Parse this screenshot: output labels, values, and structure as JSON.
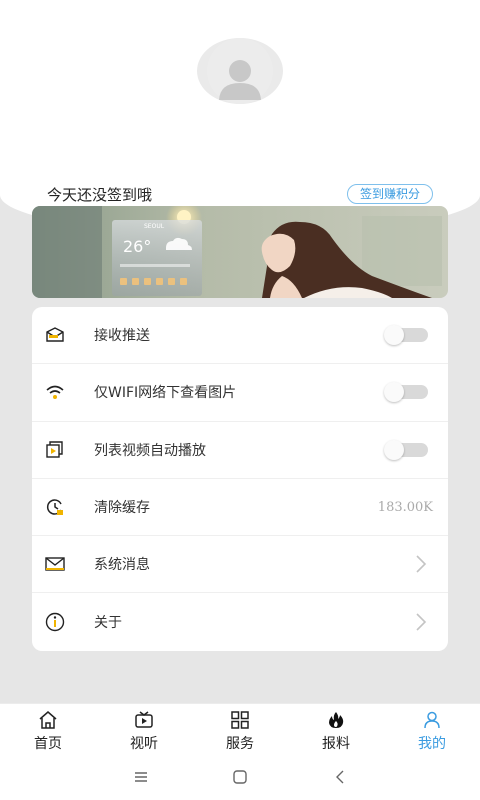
{
  "profile": {
    "signin_prompt": "今天还没签到哦",
    "signin_button": "签到赚积分"
  },
  "banner": {
    "city": "SEOUL",
    "temperature": "26°"
  },
  "settings": [
    {
      "icon": "envelope-open-icon",
      "label": "接收推送",
      "control": "toggle",
      "on": false
    },
    {
      "icon": "wifi-icon",
      "label": "仅WIFI网络下查看图片",
      "control": "toggle",
      "on": false
    },
    {
      "icon": "video-list-icon",
      "label": "列表视频自动播放",
      "control": "toggle",
      "on": false
    },
    {
      "icon": "clock-clear-icon",
      "label": "清除缓存",
      "control": "value",
      "value": "183.00K"
    },
    {
      "icon": "mail-icon",
      "label": "系统消息",
      "control": "chevron"
    },
    {
      "icon": "info-icon",
      "label": "关于",
      "control": "chevron"
    }
  ],
  "tabs": [
    {
      "icon": "home-icon",
      "label": "首页",
      "active": false
    },
    {
      "icon": "tv-icon",
      "label": "视听",
      "active": false
    },
    {
      "icon": "grid-icon",
      "label": "服务",
      "active": false
    },
    {
      "icon": "fire-icon",
      "label": "报料",
      "active": false
    },
    {
      "icon": "user-icon",
      "label": "我的",
      "active": true
    }
  ],
  "colors": {
    "accent": "#3a9be0",
    "background": "#e6e6e6",
    "icon_yellow": "#f0b400"
  }
}
